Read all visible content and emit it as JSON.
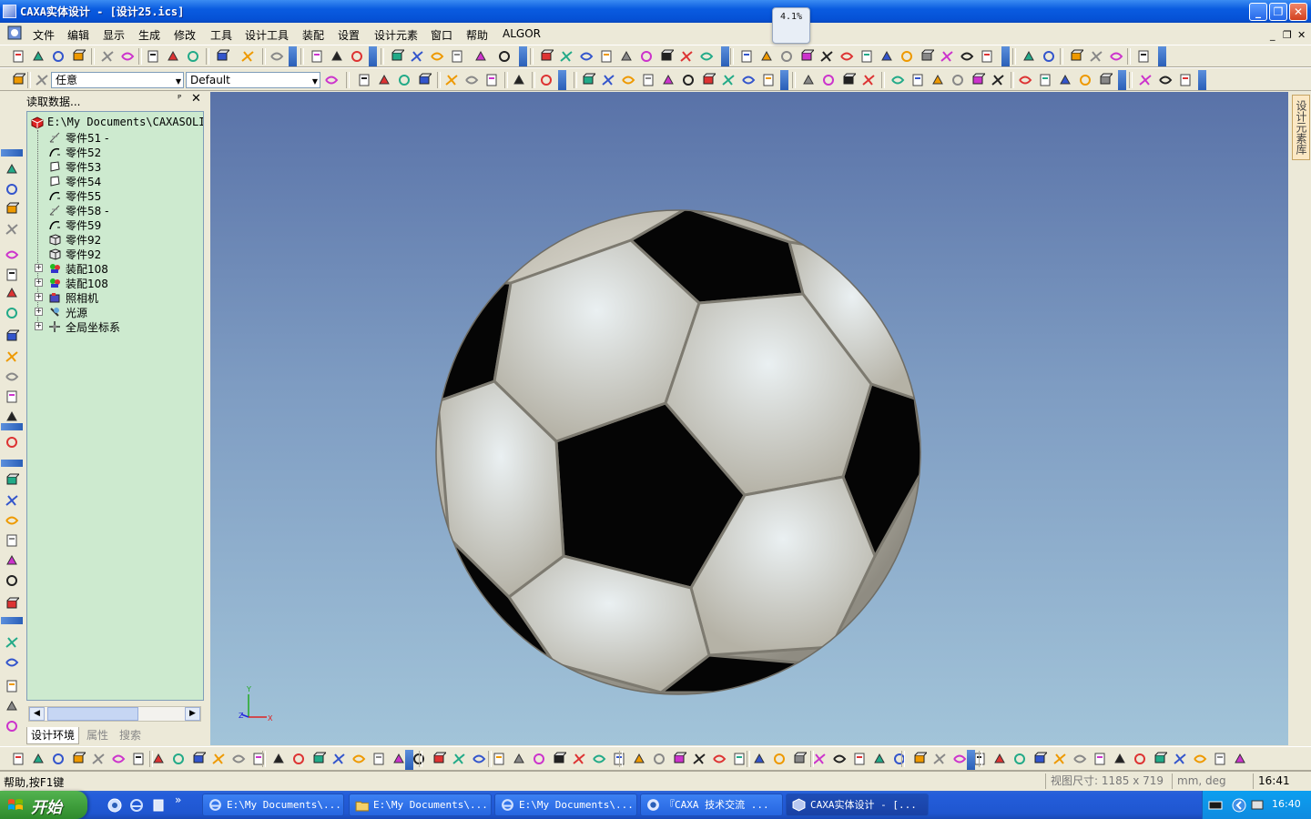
{
  "window": {
    "title": "CAXA实体设计 - [设计25.ics]",
    "zoom_badge": "4.1%",
    "minimize": "_",
    "maximize": "❐",
    "close": "✕"
  },
  "menu": {
    "items": [
      "文件",
      "编辑",
      "显示",
      "生成",
      "修改",
      "工具",
      "设计工具",
      "装配",
      "设置",
      "设计元素",
      "窗口",
      "帮助",
      "ALGOR"
    ],
    "doc_minimize": "_",
    "doc_restore": "❐",
    "doc_close": "✕"
  },
  "selector": {
    "filter_value": "任意",
    "style_value": "Default"
  },
  "panel": {
    "title": "读取数据...",
    "pin": "ᴾ",
    "close": "✕",
    "root": "E:\\My Documents\\CAXASOLI",
    "items": [
      {
        "label": "零件51 -",
        "icon": "sketch-icon",
        "expand": ""
      },
      {
        "label": "零件52",
        "icon": "curve-icon",
        "expand": ""
      },
      {
        "label": "零件53",
        "icon": "surface-icon",
        "expand": ""
      },
      {
        "label": "零件54",
        "icon": "surface-icon",
        "expand": ""
      },
      {
        "label": "零件55",
        "icon": "curve-icon",
        "expand": ""
      },
      {
        "label": "零件58 -",
        "icon": "sketch-icon",
        "expand": ""
      },
      {
        "label": "零件59",
        "icon": "curve-icon",
        "expand": ""
      },
      {
        "label": "零件92",
        "icon": "part-icon",
        "expand": ""
      },
      {
        "label": "零件92",
        "icon": "part-icon",
        "expand": ""
      },
      {
        "label": "装配108",
        "icon": "assembly-icon",
        "expand": "+"
      },
      {
        "label": "装配108",
        "icon": "assembly-icon",
        "expand": "+"
      },
      {
        "label": "照相机",
        "icon": "camera-icon",
        "expand": "+"
      },
      {
        "label": "光源",
        "icon": "light-icon",
        "expand": "+"
      },
      {
        "label": "全局坐标系",
        "icon": "coordinate-system-icon",
        "expand": "+"
      }
    ],
    "tabs": [
      "设计环境",
      "属性",
      "搜索"
    ],
    "scroll_left": "◀",
    "scroll_right": "▶"
  },
  "viewport": {
    "axis_y": "Y",
    "axis_z": "Z",
    "axis_x": "X"
  },
  "side_tab": "设计元素库",
  "status": {
    "help": "帮助,按F1键",
    "view_size": "视图尺寸: 1185 x 719",
    "units": "mm, deg",
    "time": "16:41"
  },
  "taskbar": {
    "start": "开始",
    "quicklaunch_more": "»",
    "tasks": [
      {
        "label": "E:\\My Documents\\...",
        "icon": "ie-icon",
        "active": false
      },
      {
        "label": "E:\\My Documents\\...",
        "icon": "folder-icon",
        "active": false
      },
      {
        "label": "E:\\My Documents\\...",
        "icon": "ie-icon",
        "active": false
      },
      {
        "label": "『CAXA 技术交流 ...",
        "icon": "messenger-icon",
        "active": false
      },
      {
        "label": "CAXA实体设计 - [...",
        "icon": "caxa-icon",
        "active": true
      }
    ],
    "clock": "16:40"
  },
  "colors": {
    "ball_white": "#c9c6bb",
    "ball_black": "#050505",
    "tree_bg": "#cdeacf",
    "viewport_top": "#5972a8",
    "viewport_bottom": "#a2c4d9"
  }
}
